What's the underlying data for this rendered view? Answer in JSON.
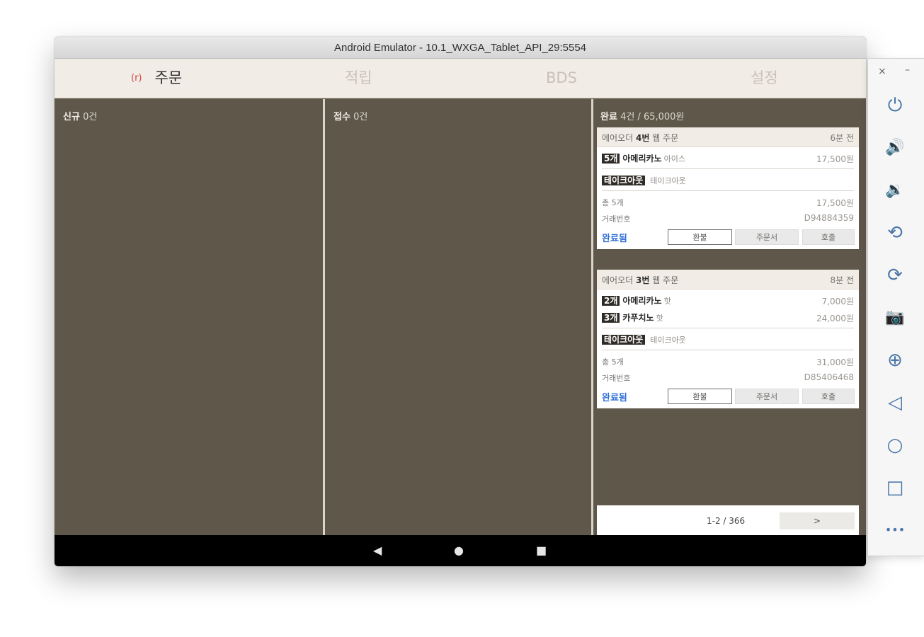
{
  "window": {
    "title": "Android Emulator - 10.1_WXGA_Tablet_API_29:5554"
  },
  "tabs": [
    {
      "label": "주문",
      "dot": "(r)"
    },
    {
      "label": "적립"
    },
    {
      "label": "BDS"
    },
    {
      "label": "설정"
    }
  ],
  "columns": {
    "new": {
      "label": "신규",
      "count": "0건"
    },
    "accepted": {
      "label": "접수",
      "count": "0건"
    },
    "completed": {
      "label": "완료",
      "count": "4건 / 65,000원"
    }
  },
  "orders": [
    {
      "prefix": "에어오더 ",
      "number": "4번",
      "suffix": " 웹 주문",
      "time": "6분 전",
      "items": [
        {
          "qty": "5개",
          "name": "아메리카노",
          "option": "아이스",
          "price": "17,500원"
        }
      ],
      "takeout_badge": "테이크아웃",
      "takeout_text": "테이크아웃",
      "total_label": "총 5개",
      "total_price": "17,500원",
      "txn_label": "거래번호",
      "txn_value": "D94884359",
      "status": "완료됨",
      "btn_refund": "환불",
      "btn_receipt": "주문서",
      "btn_call": "호출"
    },
    {
      "prefix": "에어오더 ",
      "number": "3번",
      "suffix": " 웹 주문",
      "time": "8분 전",
      "items": [
        {
          "qty": "2개",
          "name": "아메리카노",
          "option": "핫",
          "price": "7,000원"
        },
        {
          "qty": "3개",
          "name": "카푸치노",
          "option": "핫",
          "price": "24,000원"
        }
      ],
      "takeout_badge": "테이크아웃",
      "takeout_text": "테이크아웃",
      "total_label": "총 5개",
      "total_price": "31,000원",
      "txn_label": "거래번호",
      "txn_value": "D85406468",
      "status": "완료됨",
      "btn_refund": "환불",
      "btn_receipt": "주문서",
      "btn_call": "호출"
    }
  ],
  "pager": {
    "count": "1-2 / 366",
    "next": ">"
  },
  "navbar": {
    "back": "◀",
    "home": "●",
    "recents": "■"
  },
  "sidebar": {
    "close": "×",
    "minimize": "–",
    "icons": {
      "power": "⏻",
      "volume_up": "🔊",
      "volume_down": "🔉",
      "rotate_left": "⟲",
      "rotate_right": "⟳",
      "camera": "📷",
      "zoom": "⊕",
      "back": "◁",
      "home": "○",
      "overview": "□",
      "more": "•••"
    }
  },
  "colors": {
    "panel": "#5e574a",
    "accent_blue": "#2f6fd8",
    "tab_dot": "#d2453b"
  }
}
